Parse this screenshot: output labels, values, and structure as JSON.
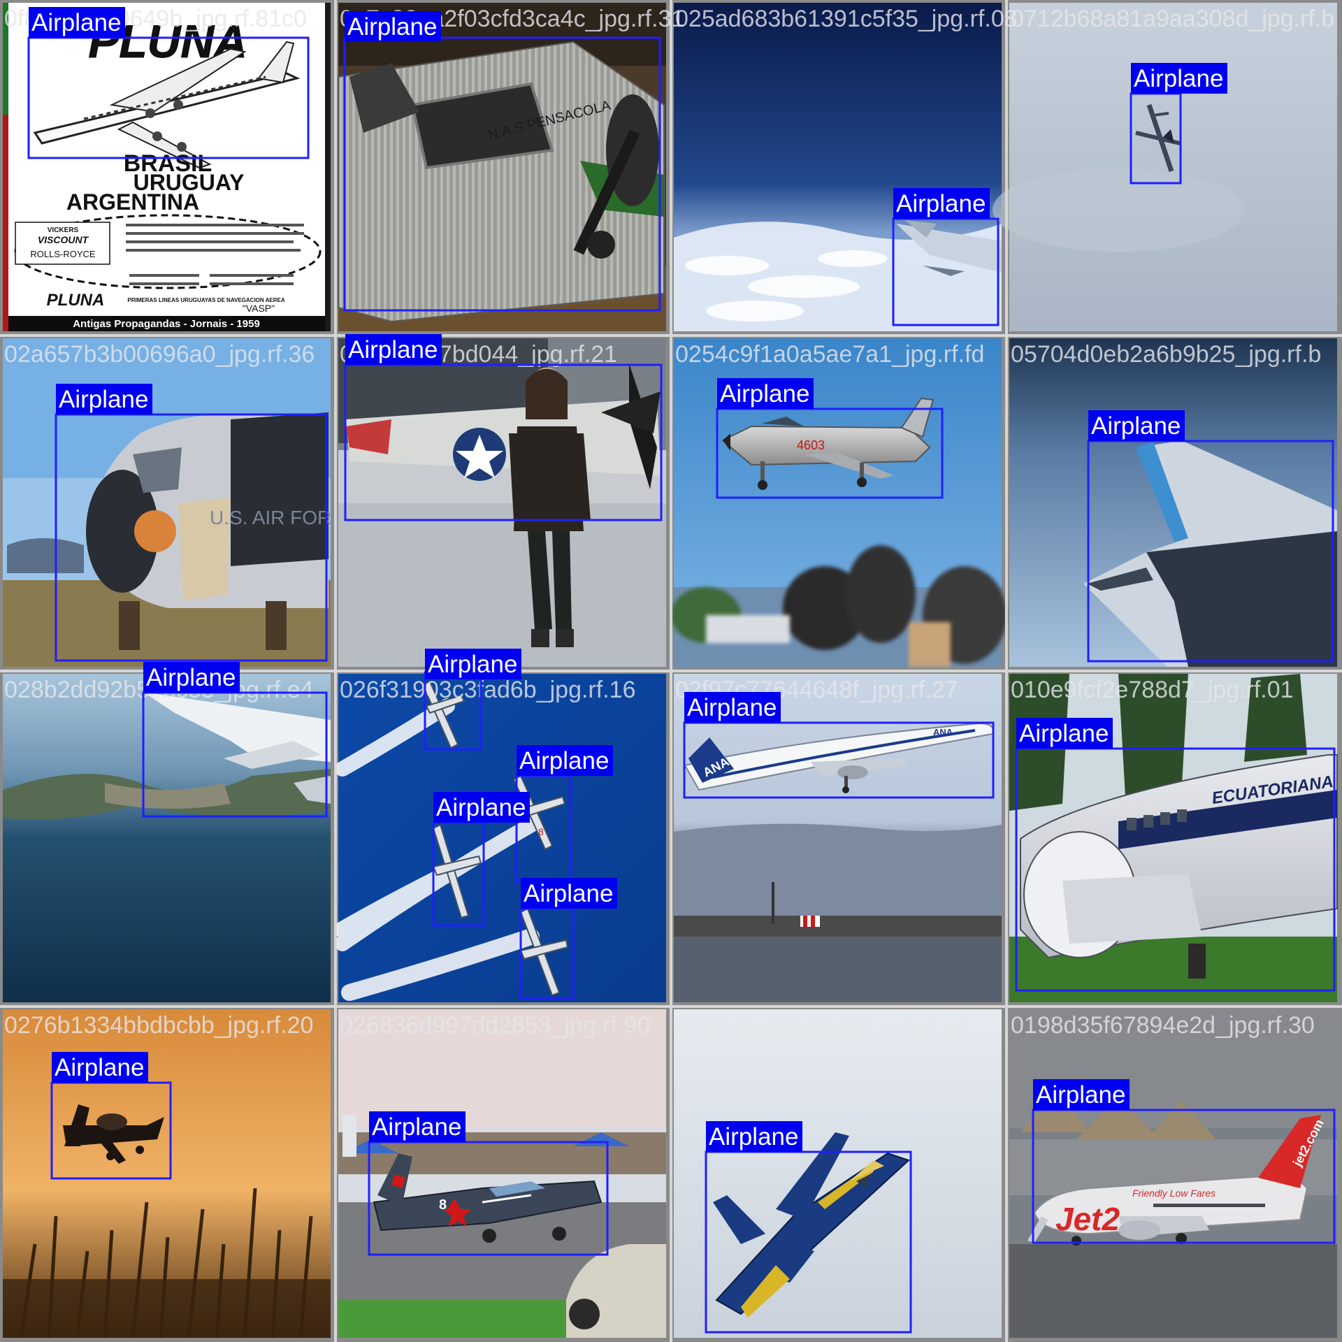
{
  "grid": {
    "columns": 4,
    "rows": 4,
    "colors": {
      "box": "#1f1fff",
      "label_bg": "#0000f0",
      "label_text": "#ffffff",
      "filename_text": "#e6e6eb",
      "tile_border": "#8a8a8a"
    }
  },
  "tiles": [
    {
      "filename": "0f8a9bf3f00649b_jpg.rf.81c0",
      "scene": "vintage-pluna-poster",
      "boxes": [
        {
          "label": "Airplane"
        }
      ]
    },
    {
      "filename": "0a7c38ea2f03cfd3ca4c_jpg.rf.31",
      "scene": "ford-trimotor-museum",
      "boxes": [
        {
          "label": "Airplane"
        }
      ]
    },
    {
      "filename": "025ad683b61391c5f35_jpg.rf.08",
      "scene": "wing-over-clouds",
      "boxes": [
        {
          "label": "Airplane"
        }
      ]
    },
    {
      "filename": "0712b68a81a9aa308d_jpg.rf.b",
      "scene": "small-plane-overcast",
      "boxes": [
        {
          "label": "Airplane"
        }
      ]
    },
    {
      "filename": "02a657b3b00696a0_jpg.rf.36",
      "scene": "kc135-nose-boneyard",
      "boxes": [
        {
          "label": "Airplane"
        }
      ]
    },
    {
      "filename": "02f1a6ab7bd044_jpg.rf.21",
      "scene": "pilot-avatar-p51",
      "boxes": [
        {
          "label": "Airplane"
        }
      ]
    },
    {
      "filename": "0254c9f1a0a5ae7a1_jpg.rf.fd",
      "scene": "mig21-airshow",
      "boxes": [
        {
          "label": "Airplane"
        }
      ]
    },
    {
      "filename": "05704d0eb2a6b9b25_jpg.rf.b",
      "scene": "wing-blue-sky",
      "boxes": [
        {
          "label": "Airplane"
        }
      ]
    },
    {
      "filename": "028b2dd92b5ebc83_jpg.rf.e4",
      "scene": "wing-over-coast",
      "boxes": [
        {
          "label": "Airplane"
        }
      ]
    },
    {
      "filename": "026f31903c3fad6b_jpg.rf.16",
      "scene": "aerobatic-formation",
      "boxes": [
        {
          "label": "Airplane"
        },
        {
          "label": "Airplane"
        },
        {
          "label": "Airplane"
        },
        {
          "label": "Airplane"
        }
      ]
    },
    {
      "filename": "02f97c77644648f_jpg.rf.27",
      "scene": "ana-777-takeoff",
      "boxes": [
        {
          "label": "Airplane"
        }
      ]
    },
    {
      "filename": "010e9fcf2e788d7_jpg.rf.01",
      "scene": "ecuatoriana-dc3",
      "boxes": [
        {
          "label": "Airplane"
        }
      ]
    },
    {
      "filename": "0276b1334bbdbcbb_jpg.rf.20",
      "scene": "sunset-aerobatic",
      "boxes": [
        {
          "label": "Airplane"
        }
      ]
    },
    {
      "filename": "026836d997dd2853_jpg.rf.90",
      "scene": "yak52-ramp",
      "boxes": [
        {
          "label": "Airplane"
        }
      ]
    },
    {
      "filename": "0306c0e596884c8_jpg.rf.ae",
      "scene": "blue-angels-hornet",
      "boxes": [
        {
          "label": "Airplane"
        }
      ]
    },
    {
      "filename": "0198d35f67894e2d_jpg.rf.30",
      "scene": "jet2-737",
      "boxes": [
        {
          "label": "Airplane"
        }
      ]
    }
  ],
  "poster": {
    "brand": "PLUNA",
    "countries": [
      "BRASIL",
      "URUGUAY",
      "ARGENTINA"
    ],
    "model": [
      "VICKERS",
      "VISCOUNT",
      "ROLLS-ROYCE"
    ],
    "footer_brand": "PLUNA",
    "footer_line": "PRIMERAS LINEAS URUGUAYAS DE NAVEGACION AEREA",
    "partner": "\"VASP\"",
    "caption": "Antigas Propagandas - Jornais - 1959"
  },
  "aircraft_text": {
    "trimotor": "N.A.S.PENSACOLA",
    "kc135": "U.S. AIR FOR",
    "mig": "4603",
    "ana": "ANA",
    "formation_mark": "8",
    "ecuatoriana": "ECUATORIANA",
    "jet2_brand": "Jet2",
    "jet2_tail": "jet2.com",
    "jet2_slogan": "Friendly Low Fares"
  }
}
